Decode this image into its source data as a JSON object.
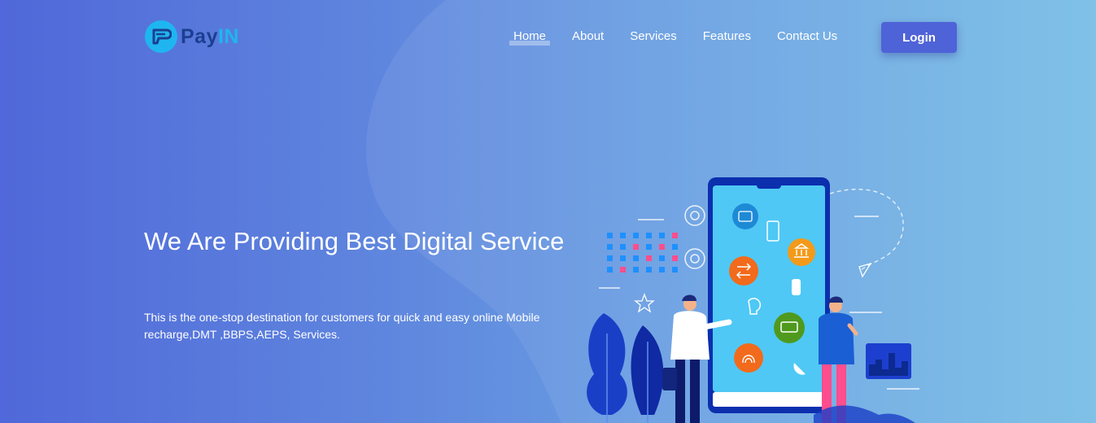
{
  "brand": {
    "pay": "Pay",
    "in": "IN"
  },
  "nav": {
    "items": [
      {
        "label": "Home",
        "active": true
      },
      {
        "label": "About",
        "active": false
      },
      {
        "label": "Services",
        "active": false
      },
      {
        "label": "Features",
        "active": false
      },
      {
        "label": "Contact Us",
        "active": false
      }
    ],
    "login_label": "Login"
  },
  "hero": {
    "title": "We Are Providing Best Digital Service",
    "description": "This is the one-stop destination for customers for quick and easy online Mobile recharge,DMT ,BBPS,AEPS, Services."
  },
  "colors": {
    "login_button": "#4f63d8",
    "logo_blue": "#1fb5f0",
    "logo_dark": "#1b3f8f",
    "phone_screen": "#4fc8f5",
    "phone_frame": "#0c2fae"
  },
  "illustration": {
    "icons": [
      "wallet-icon",
      "phone-icon",
      "bank-icon",
      "rupee-exchange-icon",
      "bottle-icon",
      "bulb-icon",
      "cash-icon",
      "fingerprint-icon",
      "satellite-dish-icon",
      "gear-icon",
      "star-icon",
      "paper-plane-icon"
    ]
  }
}
